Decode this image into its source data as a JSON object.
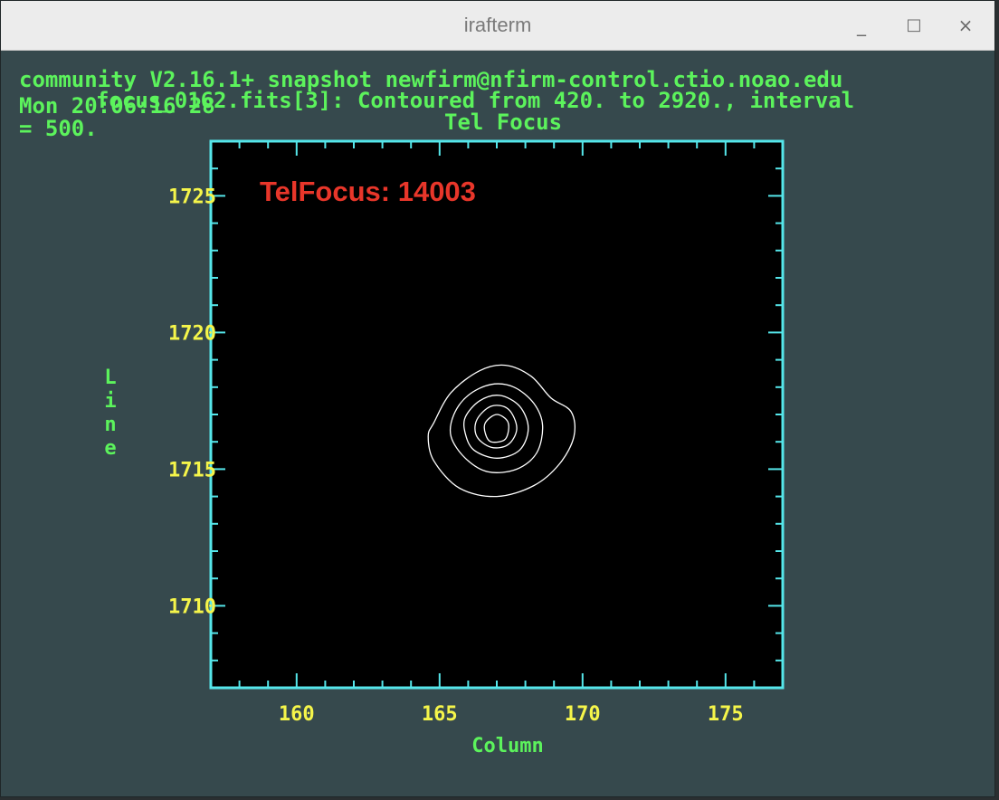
{
  "window": {
    "title": "irafterm",
    "minimize_label": "_",
    "maximize_label": "□",
    "close_label": "×"
  },
  "terminal": {
    "line1": "community V2.16.1+ snapshot newfirm@nfirm-control.ctio.noao.edu",
    "line2": "Mon 20:06:16 28",
    "line2_overlay": "focus_0162.fits[3]: Contoured from 420. to 2920., interval",
    "line3": "= 500.",
    "plot_title": "Tel Focus"
  },
  "plot": {
    "annotation": "TelFocus: 14003",
    "colors": {
      "frame": "#55e6ea",
      "tick_label": "#f5f54a",
      "axis_label": "#5cf35c",
      "annotation": "#e8362a",
      "contour": "#ffffff",
      "background": "#000000"
    }
  },
  "chart_data": {
    "type": "contour",
    "title": "Tel Focus",
    "xlabel": "Column",
    "ylabel": "Line",
    "xlim": [
      157,
      177
    ],
    "ylim": [
      1707,
      1727
    ],
    "xticks": [
      160,
      165,
      170,
      175
    ],
    "yticks": [
      1710,
      1715,
      1720,
      1725
    ],
    "contour_levels": {
      "min": 420,
      "max": 2920,
      "interval": 500
    },
    "contours": [
      {
        "points": [
          [
            164.8,
            1716.7
          ],
          [
            165.4,
            1717.8
          ],
          [
            166.4,
            1718.6
          ],
          [
            167.3,
            1718.8
          ],
          [
            168.2,
            1718.4
          ],
          [
            168.9,
            1717.6
          ],
          [
            169.6,
            1717.1
          ],
          [
            169.7,
            1716.2
          ],
          [
            169.2,
            1715.2
          ],
          [
            168.3,
            1714.4
          ],
          [
            167.0,
            1714.0
          ],
          [
            165.7,
            1714.3
          ],
          [
            164.8,
            1715.3
          ],
          [
            164.6,
            1716.2
          ]
        ]
      },
      {
        "points": [
          [
            165.5,
            1717.0
          ],
          [
            166.0,
            1717.7
          ],
          [
            166.8,
            1718.1
          ],
          [
            167.6,
            1718.0
          ],
          [
            168.3,
            1717.4
          ],
          [
            168.6,
            1716.6
          ],
          [
            168.4,
            1715.6
          ],
          [
            167.7,
            1715.0
          ],
          [
            166.7,
            1714.9
          ],
          [
            165.9,
            1715.4
          ],
          [
            165.4,
            1716.2
          ]
        ]
      },
      {
        "points": [
          [
            165.9,
            1716.9
          ],
          [
            166.4,
            1717.5
          ],
          [
            167.1,
            1717.7
          ],
          [
            167.8,
            1717.3
          ],
          [
            168.1,
            1716.5
          ],
          [
            167.8,
            1715.7
          ],
          [
            167.0,
            1715.4
          ],
          [
            166.2,
            1715.7
          ],
          [
            165.9,
            1716.3
          ]
        ]
      },
      {
        "points": [
          [
            166.3,
            1716.8
          ],
          [
            166.8,
            1717.3
          ],
          [
            167.4,
            1717.2
          ],
          [
            167.7,
            1716.5
          ],
          [
            167.4,
            1715.9
          ],
          [
            166.8,
            1715.8
          ],
          [
            166.3,
            1716.2
          ]
        ]
      },
      {
        "points": [
          [
            166.6,
            1716.7
          ],
          [
            167.0,
            1717.0
          ],
          [
            167.4,
            1716.7
          ],
          [
            167.3,
            1716.1
          ],
          [
            166.8,
            1716.0
          ],
          [
            166.6,
            1716.3
          ]
        ]
      }
    ]
  }
}
